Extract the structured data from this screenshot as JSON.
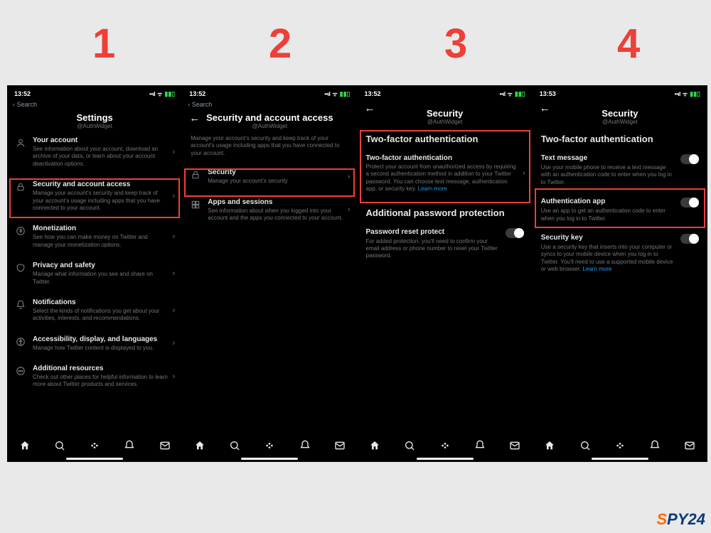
{
  "step_labels": {
    "s1": "1",
    "s2": "2",
    "s3": "3",
    "s4": "4"
  },
  "statusbar": {
    "time_a": "13:52",
    "time_d": "13:53",
    "back_label": "Search"
  },
  "handle": "@AuthWidget",
  "watermark": {
    "a": "S",
    "b": "P",
    "c": "Y",
    "d": "24"
  },
  "screen1": {
    "title": "Settings",
    "rows": {
      "account": {
        "label": "Your account",
        "desc": "See information about your account, download an archive of your data, or learn about your account deactivation options."
      },
      "security": {
        "label": "Security and account access",
        "desc": "Manage your account's security and keep track of your account's usage including apps that you have connected to your account."
      },
      "monetization": {
        "label": "Monetization",
        "desc": "See how you can make money on Twitter and manage your monetization options."
      },
      "privacy": {
        "label": "Privacy and safety",
        "desc": "Manage what information you see and share on Twitter."
      },
      "notifications": {
        "label": "Notifications",
        "desc": "Select the kinds of notifications you get about your activities, interests, and recommendations."
      },
      "accessibility": {
        "label": "Accessibility, display, and languages",
        "desc": "Manage how Twitter content is displayed to you."
      },
      "additional": {
        "label": "Additional resources",
        "desc": "Check out other places for helpful information to learn more about Twitter products and services."
      }
    }
  },
  "screen2": {
    "title": "Security and account access",
    "intro": "Manage your account's security and keep track of your account's usage including apps that you have connected to your account.",
    "security": {
      "label": "Security",
      "desc": "Manage your account's security"
    },
    "apps": {
      "label": "Apps and sessions",
      "desc": "See information about when you logged into your account and the apps you connected to your account."
    }
  },
  "screen3": {
    "title": "Security",
    "section1": "Two-factor authentication",
    "twofa": {
      "label": "Two-factor authentication",
      "desc": "Protect your account from unauthorized access by requiring a second authentication method in addition to your Twitter password. You can choose text message, authentication app, or security key. ",
      "link": "Learn more"
    },
    "section2": "Additional password protection",
    "reset": {
      "label": "Password reset protect",
      "desc": "For added protection, you'll need to confirm your email address or phone number to reset your Twitter password."
    }
  },
  "screen4": {
    "title": "Security",
    "section": "Two-factor authentication",
    "text_msg": {
      "label": "Text message",
      "desc": "Use your mobile phone to receive a text message with an authentication code to enter when you log in to Twitter."
    },
    "auth_app": {
      "label": "Authentication app",
      "desc": "Use an app to get an authentication code to enter when you log in to Twitter."
    },
    "sec_key": {
      "label": "Security key",
      "desc": "Use a security key that inserts into your computer or syncs to your mobile device when you log in to Twitter. You'll need to use a supported mobile device or web browser. ",
      "link": "Learn more"
    }
  }
}
